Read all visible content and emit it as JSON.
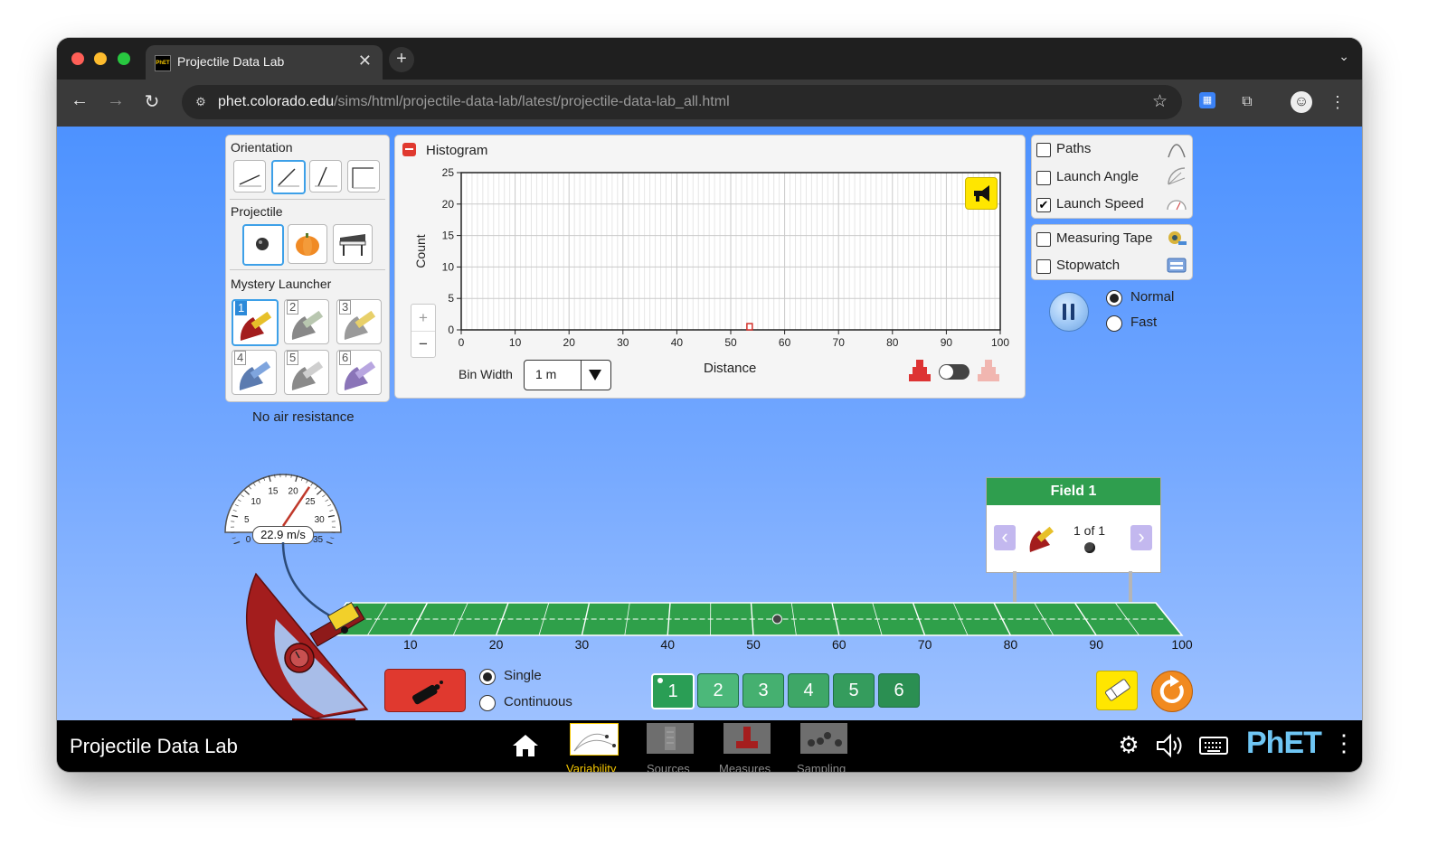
{
  "browser": {
    "tab_title": "Projectile Data Lab",
    "favicon_text": "PhET",
    "new_tab_glyph": "+",
    "url_host": "phet.colorado.edu",
    "url_path": "/sims/html/projectile-data-lab/latest/projectile-data-lab_all.html",
    "icons": [
      "back-arrow-icon",
      "forward-arrow-icon",
      "reload-icon",
      "site-settings-icon",
      "star-icon",
      "extension-icon",
      "puzzle-icon",
      "profile-avatar",
      "kebab-menu-icon"
    ],
    "traffic_light_colors": [
      "#ff5f57",
      "#febc2e",
      "#28c840"
    ]
  },
  "left_panel": {
    "orientation_title": "Orientation",
    "projectile_title": "Projectile",
    "mystery_title": "Mystery Launcher",
    "mystery_numbers": [
      "1",
      "2",
      "3",
      "4",
      "5",
      "6"
    ],
    "selected_launcher": 1,
    "air_resistance_text": "No air resistance"
  },
  "histogram": {
    "title": "Histogram",
    "ylabel": "Count",
    "xlabel": "Distance",
    "zoom_in": "+",
    "zoom_out": "−",
    "bin_width_label": "Bin Width",
    "bin_width_value": "1 m",
    "accent": "#ffe600"
  },
  "chart_data": {
    "type": "bar",
    "xlabel": "Distance",
    "ylabel": "Count",
    "xlim": [
      0,
      100
    ],
    "ylim": [
      0,
      25
    ],
    "x_ticks": [
      0,
      10,
      20,
      30,
      40,
      50,
      60,
      70,
      80,
      90,
      100
    ],
    "y_ticks": [
      0,
      5,
      10,
      15,
      20,
      25
    ],
    "bin_width": 1,
    "bins": [
      {
        "x": 53,
        "count": 1
      }
    ],
    "grid": true
  },
  "right_panel": {
    "checkboxes": [
      {
        "label": "Paths",
        "checked": false
      },
      {
        "label": "Launch Angle",
        "checked": false
      },
      {
        "label": "Launch Speed",
        "checked": true
      }
    ],
    "tools": [
      {
        "label": "Measuring Tape",
        "checked": false
      },
      {
        "label": "Stopwatch",
        "checked": false
      }
    ],
    "speed_normal": "Normal",
    "speed_fast": "Fast",
    "speed_selected": "Normal"
  },
  "speedometer": {
    "readout": "22.9 m/s",
    "ticks": [
      "0",
      "5",
      "10",
      "15",
      "20",
      "25",
      "30",
      "35"
    ],
    "value": 22.9,
    "max": 35
  },
  "field_sign": {
    "title": "Field 1",
    "page_text": "1 of 1",
    "prev_glyph": "‹",
    "next_glyph": "›"
  },
  "field": {
    "ticks": [
      "10",
      "20",
      "30",
      "40",
      "50",
      "60",
      "70",
      "80",
      "90",
      "100"
    ],
    "landed_at": 53
  },
  "launch_controls": {
    "single": "Single",
    "continuous": "Continuous",
    "mode_selected": "Single",
    "field_buttons": [
      "1",
      "2",
      "3",
      "4",
      "5",
      "6"
    ],
    "selected_field": "1"
  },
  "navbar": {
    "sim_title": "Projectile Data Lab",
    "screens": [
      "Variability",
      "Sources",
      "Measures",
      "Sampling"
    ],
    "active_screen": "Variability",
    "logo": "PhET",
    "active_color": "#f6c800"
  }
}
